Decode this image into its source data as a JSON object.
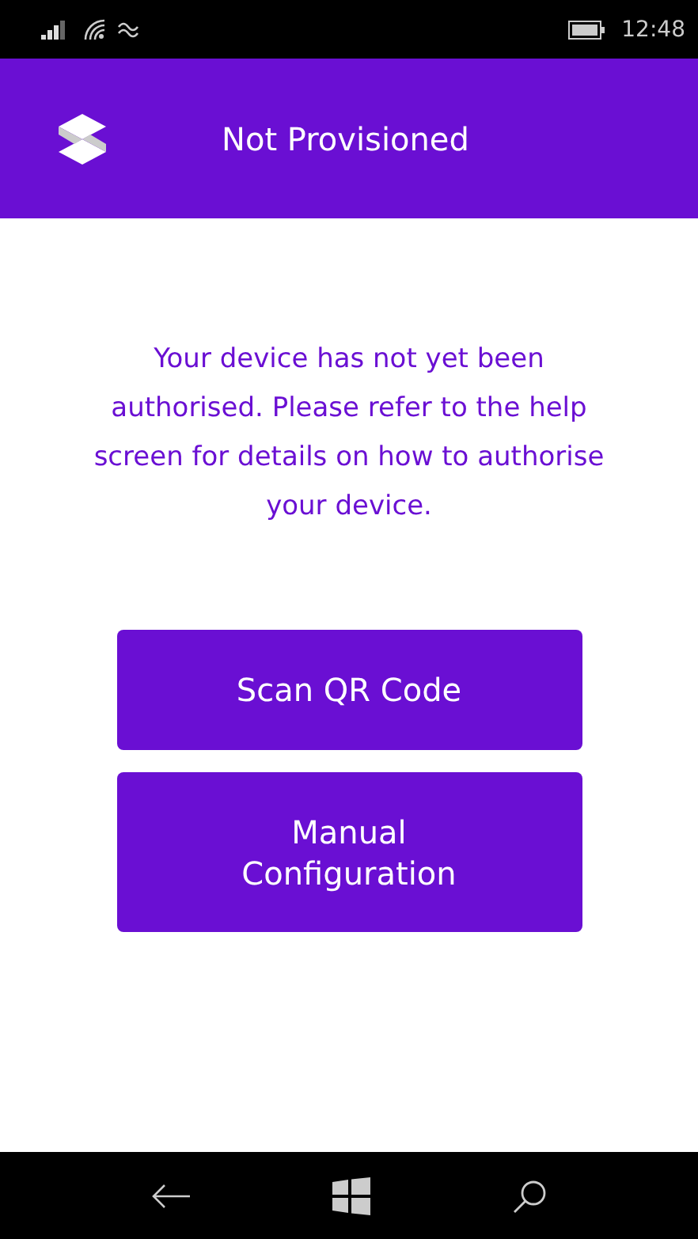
{
  "status_bar": {
    "time": "12:48"
  },
  "header": {
    "title": "Not Provisioned"
  },
  "message": "Your device has not yet been authorised. Please refer to the help screen for details on how to authorise your device.",
  "buttons": [
    {
      "label": "Scan QR Code"
    },
    {
      "label": "Manual Configuration"
    }
  ]
}
